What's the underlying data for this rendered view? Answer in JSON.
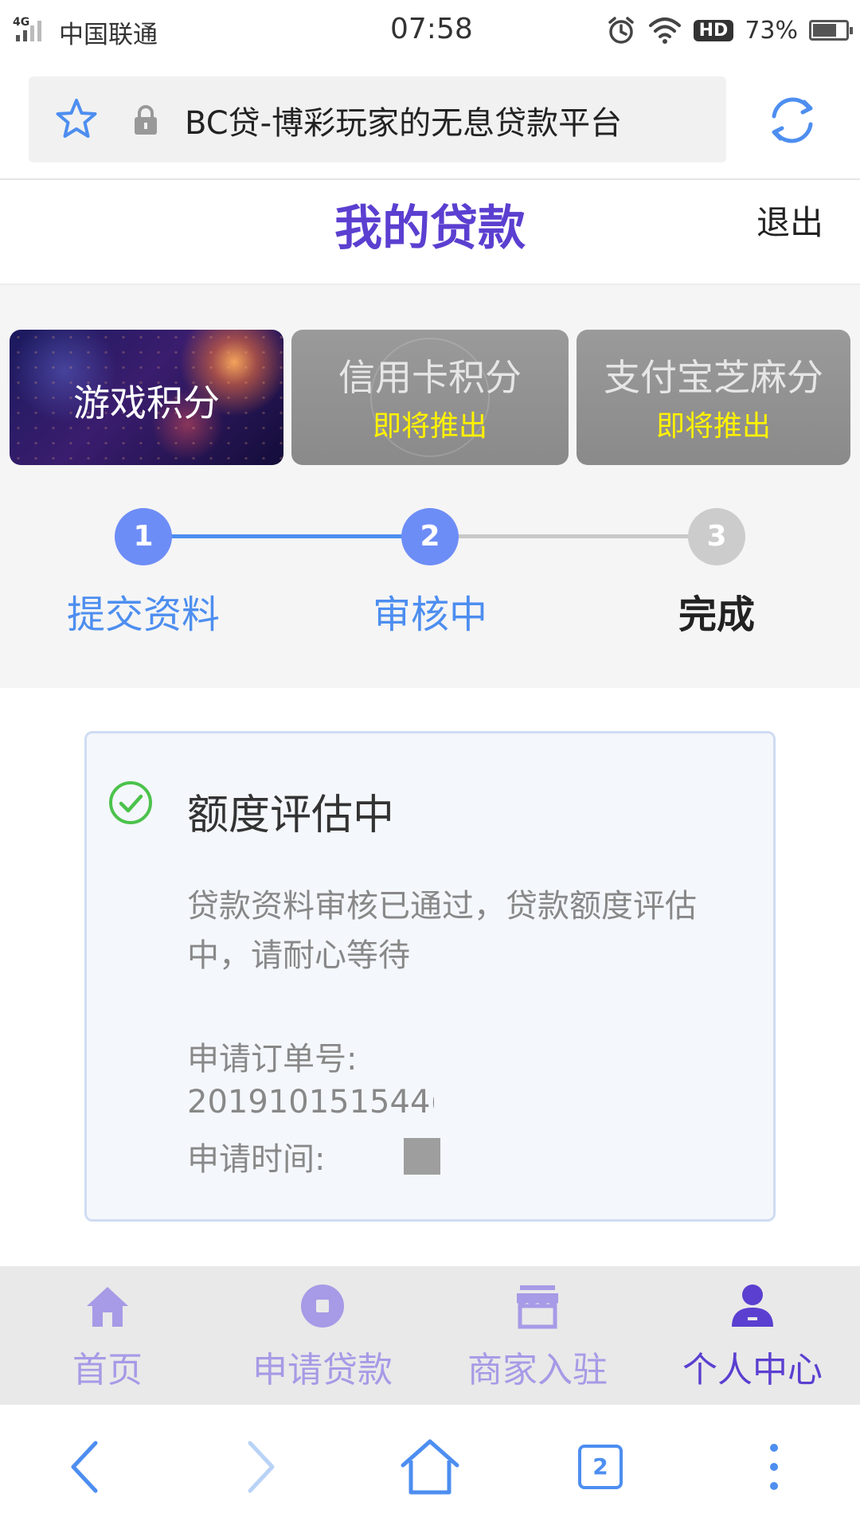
{
  "status_bar": {
    "network": "4G",
    "carrier": "中国联通",
    "time": "07:58",
    "hd_label": "HD",
    "battery_percent": "73%",
    "battery_level": 0.73
  },
  "browser": {
    "url_text": "BC贷-博彩玩家的无息贷款平台",
    "icons": [
      "star-icon",
      "lock-icon",
      "refresh-icon"
    ]
  },
  "header": {
    "title": "我的贷款",
    "logout_label": "退出"
  },
  "score_cards": [
    {
      "label": "游戏积分",
      "status": ""
    },
    {
      "label": "信用卡积分",
      "status": "即将推出"
    },
    {
      "label": "支付宝芝麻分",
      "status": "即将推出"
    }
  ],
  "steps": [
    {
      "number": "1",
      "label": "提交资料",
      "state": "done"
    },
    {
      "number": "2",
      "label": "审核中",
      "state": "current"
    },
    {
      "number": "3",
      "label": "完成",
      "state": "todo"
    }
  ],
  "status_card": {
    "title": "额度评估中",
    "description": "贷款资料审核已通过，贷款额度评估中，请耐心等待",
    "order_label": "申请订单号:",
    "order_number": "201910151544(",
    "time_label": "申请时间:",
    "accent_color": "#4cc24c"
  },
  "app_nav": {
    "items": [
      {
        "label": "首页",
        "icon": "home-icon"
      },
      {
        "label": "申请贷款",
        "icon": "apply-loan-icon"
      },
      {
        "label": "商家入驻",
        "icon": "store-icon"
      },
      {
        "label": "个人中心",
        "icon": "user-icon",
        "active": true
      }
    ],
    "active_color": "#5b3fd0",
    "inactive_color": "#a79ae6"
  },
  "browser_nav": {
    "tabs_count": "2",
    "icons": [
      "back-icon",
      "forward-icon",
      "home-icon",
      "tabs-icon",
      "more-icon"
    ]
  }
}
